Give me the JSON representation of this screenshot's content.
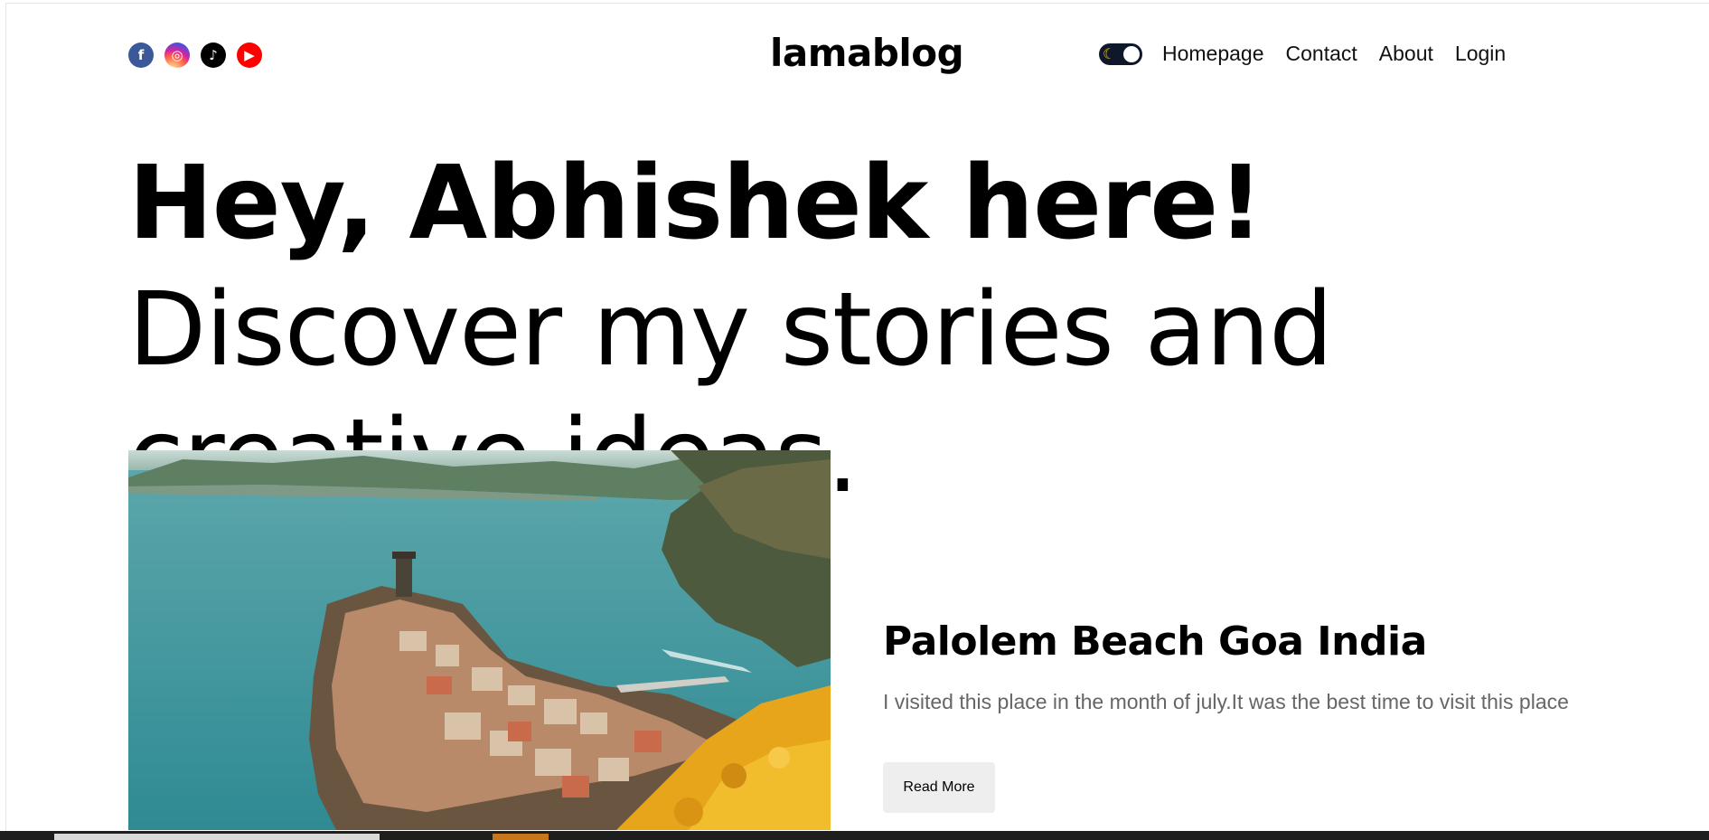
{
  "header": {
    "logo": "lamablog",
    "socials": [
      {
        "name": "facebook",
        "glyph": "f",
        "color": "#3b5998"
      },
      {
        "name": "instagram",
        "glyph": "◎",
        "color": "#d6249f"
      },
      {
        "name": "tiktok",
        "glyph": "♪",
        "color": "#000000"
      },
      {
        "name": "youtube",
        "glyph": "▶",
        "color": "#ff0000"
      }
    ],
    "theme_toggle": {
      "icon": "moon-icon",
      "state": "dark"
    },
    "nav": {
      "homepage": "Homepage",
      "contact": "Contact",
      "about": "About",
      "login": "Login"
    }
  },
  "hero": {
    "bold_text": "Hey, Abhishek here!",
    "light_text": " Discover my stories and creative ideas."
  },
  "featured_post": {
    "image": "coastal-cliff-village-photo",
    "title": "Palolem Beach Goa India",
    "description": "I visited this place in the month of july.It was the best time to visit this place",
    "button": "Read More"
  }
}
